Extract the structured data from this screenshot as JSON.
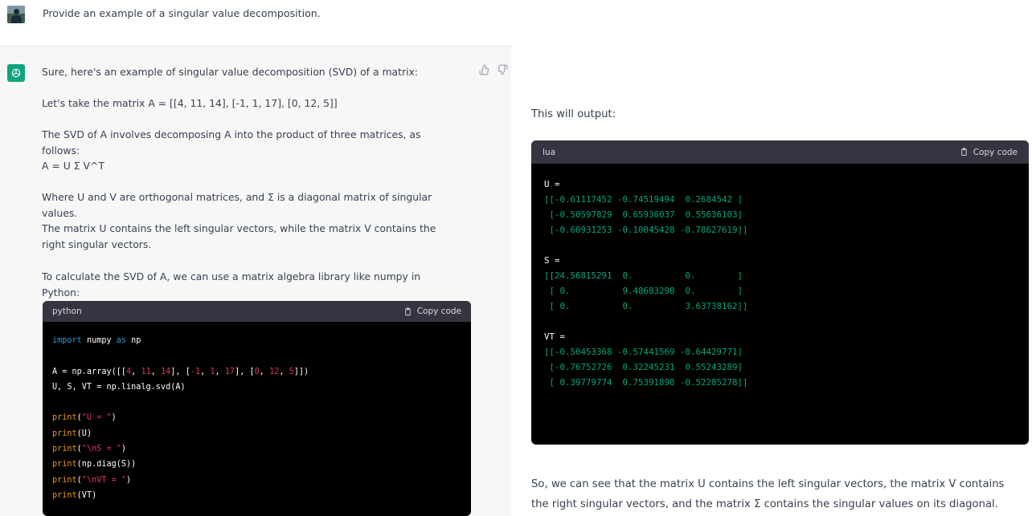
{
  "user_message": "Provide an example of a singular value decomposition.",
  "assistant": {
    "paragraphs": [
      "Sure, here's an example of singular value decomposition (SVD) of a matrix:",
      "Let's take the matrix A = [[4, 11, 14], [-1, 1, 17], [0, 12, 5]]",
      "The SVD of A involves decomposing A into the product of three matrices, as follows:",
      "A = U Σ V^T",
      "Where U and V are orthogonal matrices, and Σ is a diagonal matrix of singular values.",
      "The matrix U contains the left singular vectors, while the matrix V contains the right singular vectors.",
      "To calculate the SVD of A, we can use a matrix algebra library like numpy in Python:"
    ],
    "code_block_1": {
      "language": "python",
      "copy_label": "Copy code"
    },
    "output_intro": "This will output:",
    "code_block_2": {
      "language": "lua",
      "copy_label": "Copy code"
    },
    "conclusion": [
      "So, we can see that the matrix U contains the left singular vectors, the matrix V contains",
      "the right singular vectors, and the matrix Σ contains the singular values on its diagonal."
    ]
  },
  "icons": [
    "avatar",
    "openai-logo-icon",
    "thumbs-up-icon",
    "thumbs-down-icon",
    "clipboard-icon"
  ],
  "colors": {
    "bot_bg": "#f7f7f8",
    "code_bg": "#000000",
    "code_header": "#343541",
    "accent": "#10a37f"
  }
}
